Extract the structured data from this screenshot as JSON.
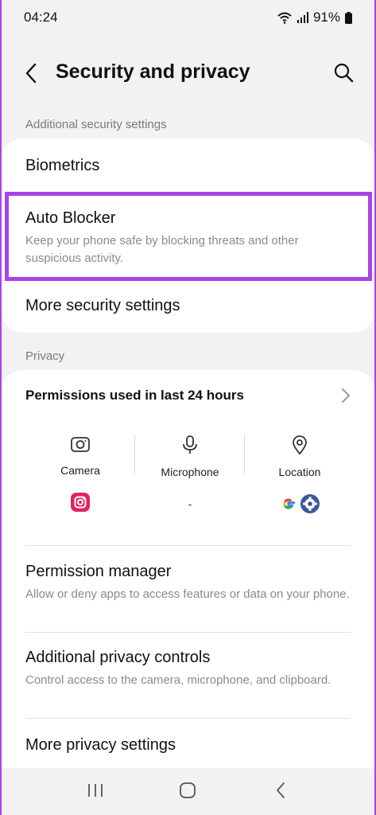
{
  "status": {
    "time": "04:24",
    "battery": "91%"
  },
  "header": {
    "title": "Security and privacy"
  },
  "sections": {
    "additional_security": "Additional security settings",
    "privacy": "Privacy"
  },
  "security_items": [
    {
      "title": "Biometrics"
    },
    {
      "title": "Auto Blocker",
      "subtitle": "Keep your phone safe by blocking threats and other suspicious activity."
    },
    {
      "title": "More security settings"
    }
  ],
  "permissions": {
    "title": "Permissions used in last 24 hours",
    "columns": [
      {
        "label": "Camera",
        "icon": "camera-icon",
        "apps": [
          "instagram-icon"
        ]
      },
      {
        "label": "Microphone",
        "icon": "microphone-icon",
        "apps_text": "-"
      },
      {
        "label": "Location",
        "icon": "location-icon",
        "apps": [
          "google-icon",
          "settings-icon"
        ]
      }
    ]
  },
  "privacy_items": [
    {
      "title": "Permission manager",
      "subtitle": "Allow or deny apps to access features or data on your phone."
    },
    {
      "title": "Additional privacy controls",
      "subtitle": "Control access to the camera, microphone, and clipboard."
    },
    {
      "title": "More privacy settings"
    }
  ],
  "colors": {
    "highlight": "#a743e8",
    "instagram": "#e0245e",
    "settings": "#3b5998"
  }
}
